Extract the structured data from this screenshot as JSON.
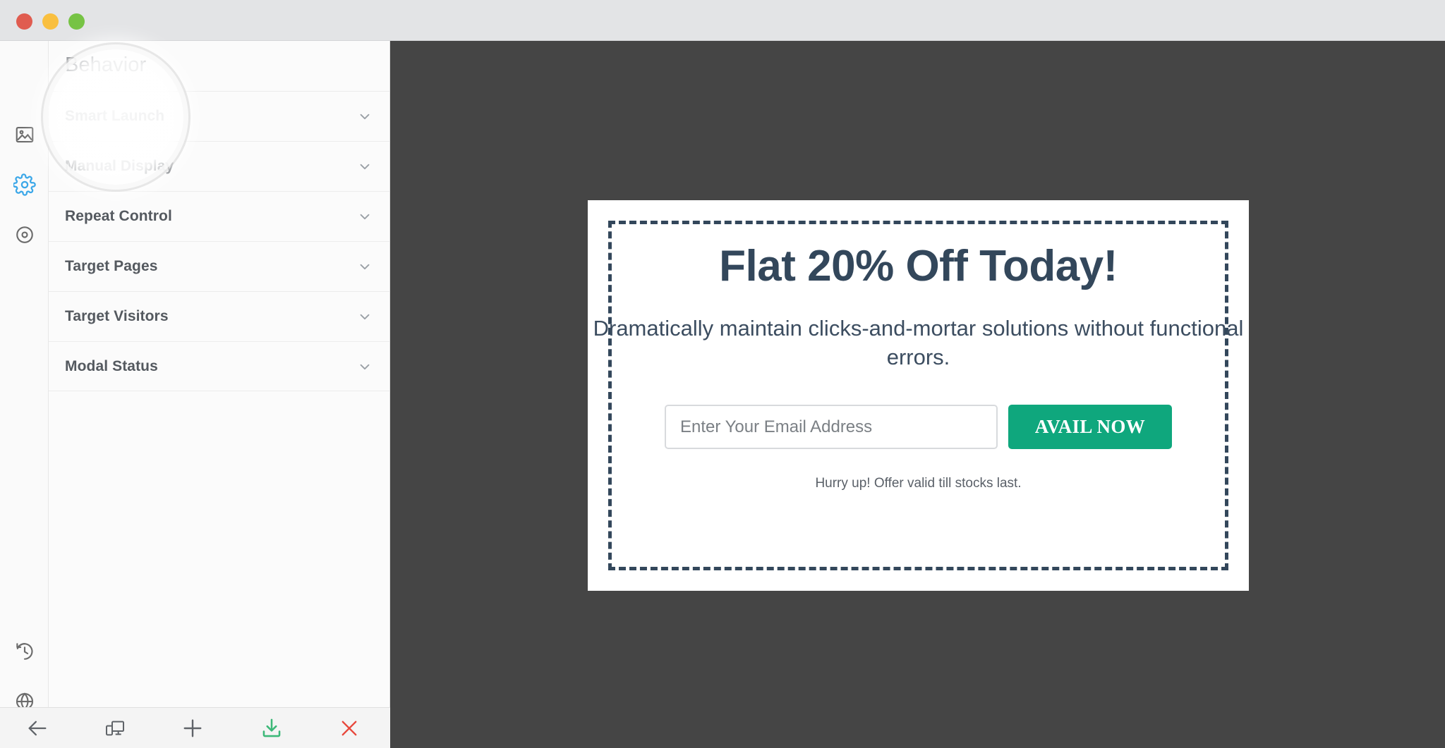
{
  "window": {
    "traffic_lights": [
      {
        "name": "close",
        "color": "#e05c50"
      },
      {
        "name": "minimize",
        "color": "#f9bf3f"
      },
      {
        "name": "maximize",
        "color": "#76c344"
      }
    ]
  },
  "icon_rail": {
    "items": [
      {
        "icon": "image-icon",
        "active": false
      },
      {
        "icon": "gear-icon",
        "active": true
      },
      {
        "icon": "target-icon",
        "active": false
      },
      {
        "icon": "history-icon",
        "active": false
      },
      {
        "icon": "globe-icon",
        "active": false
      }
    ]
  },
  "panel": {
    "title": "Behavior",
    "sections": [
      {
        "label": "Smart Launch",
        "chevron": "chevron-down-icon"
      },
      {
        "label": "Manual Display",
        "chevron": "chevron-down-icon"
      },
      {
        "label": "Repeat Control",
        "chevron": "chevron-down-icon"
      },
      {
        "label": "Target Pages",
        "chevron": "chevron-down-icon"
      },
      {
        "label": "Target Visitors",
        "chevron": "chevron-down-icon"
      },
      {
        "label": "Modal Status",
        "chevron": "chevron-down-icon"
      }
    ]
  },
  "toolbar": {
    "items": [
      {
        "icon": "back-arrow-icon",
        "color": "#5f6368"
      },
      {
        "icon": "responsive-device-icon",
        "color": "#5f6368"
      },
      {
        "icon": "plus-icon",
        "color": "#5f6368"
      },
      {
        "icon": "download-save-icon",
        "color": "#3cb878"
      },
      {
        "icon": "close-x-icon",
        "color": "#e8483c"
      }
    ]
  },
  "canvas": {
    "background": "#454545"
  },
  "modal": {
    "heading": "Flat 20% Off Today!",
    "subheading": "Dramatically maintain clicks-and-mortar solutions without functional errors.",
    "email_value": "",
    "email_placeholder": "Enter Your Email Address",
    "cta_label": "AVAIL NOW",
    "note": "Hurry up! Offer valid till stocks last.",
    "close_icon": "close-x-icon",
    "accent_color": "#0fa77d",
    "text_color": "#33475b",
    "border_style": "dashed"
  }
}
